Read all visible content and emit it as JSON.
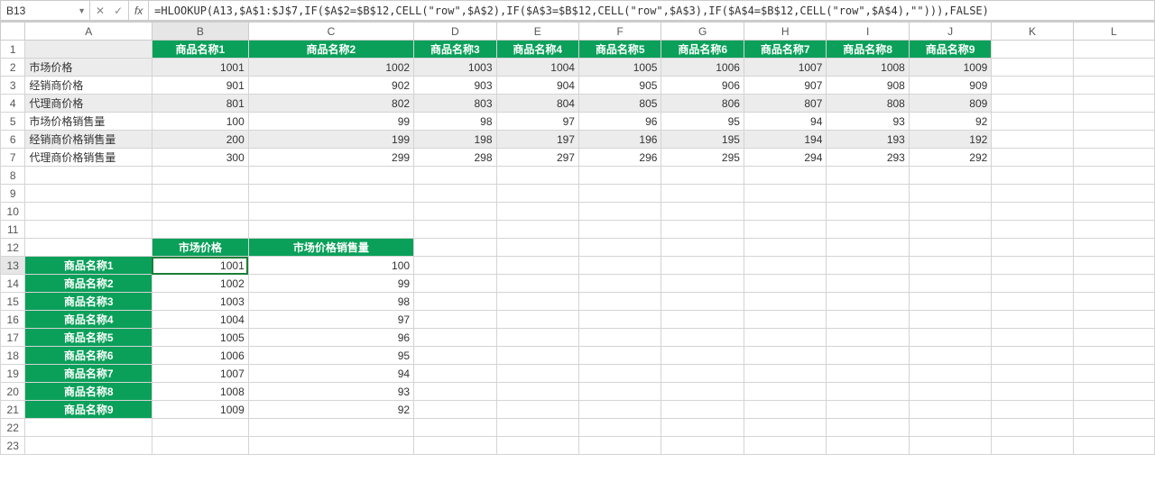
{
  "formula_bar": {
    "name_box": "B13",
    "fx_label": "fx",
    "formula": "=HLOOKUP(A13,$A$1:$J$7,IF($A$2=$B$12,CELL(\"row\",$A$2),IF($A$3=$B$12,CELL(\"row\",$A$3),IF($A$4=$B$12,CELL(\"row\",$A$4),\"\"))),FALSE)"
  },
  "columns": [
    "A",
    "B",
    "C",
    "D",
    "E",
    "F",
    "G",
    "H",
    "I",
    "J",
    "K",
    "L"
  ],
  "active_cell": {
    "col": "B",
    "row": 13
  },
  "table1": {
    "col_headers": [
      "商品名称1",
      "商品名称2",
      "商品名称3",
      "商品名称4",
      "商品名称5",
      "商品名称6",
      "商品名称7",
      "商品名称8",
      "商品名称9"
    ],
    "rows": [
      {
        "label": "市场价格",
        "values": [
          1001,
          1002,
          1003,
          1004,
          1005,
          1006,
          1007,
          1008,
          1009
        ],
        "shade": true
      },
      {
        "label": "经销商价格",
        "values": [
          901,
          902,
          903,
          904,
          905,
          906,
          907,
          908,
          909
        ],
        "shade": false
      },
      {
        "label": "代理商价格",
        "values": [
          801,
          802,
          803,
          804,
          805,
          806,
          807,
          808,
          809
        ],
        "shade": true
      },
      {
        "label": "市场价格销售量",
        "values": [
          100,
          99,
          98,
          97,
          96,
          95,
          94,
          93,
          92
        ],
        "shade": false
      },
      {
        "label": "经销商价格销售量",
        "values": [
          200,
          199,
          198,
          197,
          196,
          195,
          194,
          193,
          192
        ],
        "shade": true
      },
      {
        "label": "代理商价格销售量",
        "values": [
          300,
          299,
          298,
          297,
          296,
          295,
          294,
          293,
          292
        ],
        "shade": false
      }
    ]
  },
  "table2": {
    "header_b": "市场价格",
    "header_c": "市场价格销售量",
    "rows": [
      {
        "label": "商品名称1",
        "b": 1001,
        "c": 100
      },
      {
        "label": "商品名称2",
        "b": 1002,
        "c": 99
      },
      {
        "label": "商品名称3",
        "b": 1003,
        "c": 98
      },
      {
        "label": "商品名称4",
        "b": 1004,
        "c": 97
      },
      {
        "label": "商品名称5",
        "b": 1005,
        "c": 96
      },
      {
        "label": "商品名称6",
        "b": 1006,
        "c": 95
      },
      {
        "label": "商品名称7",
        "b": 1007,
        "c": 94
      },
      {
        "label": "商品名称8",
        "b": 1008,
        "c": 93
      },
      {
        "label": "商品名称9",
        "b": 1009,
        "c": 92
      }
    ]
  },
  "chart_data": {
    "type": "table",
    "title": "",
    "tables": [
      {
        "columns": [
          "",
          "商品名称1",
          "商品名称2",
          "商品名称3",
          "商品名称4",
          "商品名称5",
          "商品名称6",
          "商品名称7",
          "商品名称8",
          "商品名称9"
        ],
        "rows": [
          [
            "市场价格",
            1001,
            1002,
            1003,
            1004,
            1005,
            1006,
            1007,
            1008,
            1009
          ],
          [
            "经销商价格",
            901,
            902,
            903,
            904,
            905,
            906,
            907,
            908,
            909
          ],
          [
            "代理商价格",
            801,
            802,
            803,
            804,
            805,
            806,
            807,
            808,
            809
          ],
          [
            "市场价格销售量",
            100,
            99,
            98,
            97,
            96,
            95,
            94,
            93,
            92
          ],
          [
            "经销商价格销售量",
            200,
            199,
            198,
            197,
            196,
            195,
            194,
            193,
            192
          ],
          [
            "代理商价格销售量",
            300,
            299,
            298,
            297,
            296,
            295,
            294,
            293,
            292
          ]
        ]
      },
      {
        "columns": [
          "",
          "市场价格",
          "市场价格销售量"
        ],
        "rows": [
          [
            "商品名称1",
            1001,
            100
          ],
          [
            "商品名称2",
            1002,
            99
          ],
          [
            "商品名称3",
            1003,
            98
          ],
          [
            "商品名称4",
            1004,
            97
          ],
          [
            "商品名称5",
            1005,
            96
          ],
          [
            "商品名称6",
            1006,
            95
          ],
          [
            "商品名称7",
            1007,
            94
          ],
          [
            "商品名称8",
            1008,
            93
          ],
          [
            "商品名称9",
            1009,
            92
          ]
        ]
      }
    ]
  }
}
